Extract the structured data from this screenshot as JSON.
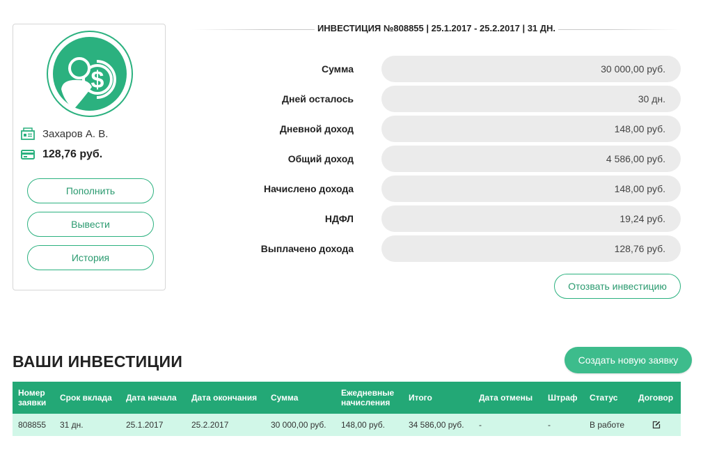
{
  "profile": {
    "name": "Захаров А. В.",
    "balance": "128,76 руб.",
    "buttons": {
      "deposit": "Пополнить",
      "withdraw": "Вывести",
      "history": "История"
    },
    "accent_color": "#2bb17f"
  },
  "investment": {
    "title": "ИНВЕСТИЦИЯ №808855 | 25.1.2017 - 25.2.2017 | 31 ДН.",
    "details": [
      {
        "label": "Сумма",
        "value": "30 000,00 руб."
      },
      {
        "label": "Дней осталось",
        "value": "30 дн."
      },
      {
        "label": "Дневной доход",
        "value": "148,00 руб."
      },
      {
        "label": "Общий доход",
        "value": "4 586,00 руб."
      },
      {
        "label": "Начислено дохода",
        "value": "148,00 руб."
      },
      {
        "label": "НДФЛ",
        "value": "19,24 руб."
      },
      {
        "label": "Выплачено дохода",
        "value": "128,76 руб."
      }
    ],
    "withdraw_button": "Отозвать инвестицию"
  },
  "list": {
    "title": "ВАШИ ИНВЕСТИЦИИ",
    "create_button": "Создать новую заявку",
    "columns": [
      "Номер заявки",
      "Срок вклада",
      "Дата начала",
      "Дата окончания",
      "Сумма",
      "Ежедневные начисления",
      "Итого",
      "Дата отмены",
      "Штраф",
      "Статус",
      "Договор"
    ],
    "rows": [
      [
        "808855",
        "31 дн.",
        "25.1.2017",
        "25.2.2017",
        "30 000,00 руб.",
        "148,00 руб.",
        "34 586,00 руб.",
        "-",
        "-",
        "В работе",
        "edit-icon"
      ]
    ],
    "header_color": "#23a876",
    "row_color": "#d1f7e8"
  }
}
